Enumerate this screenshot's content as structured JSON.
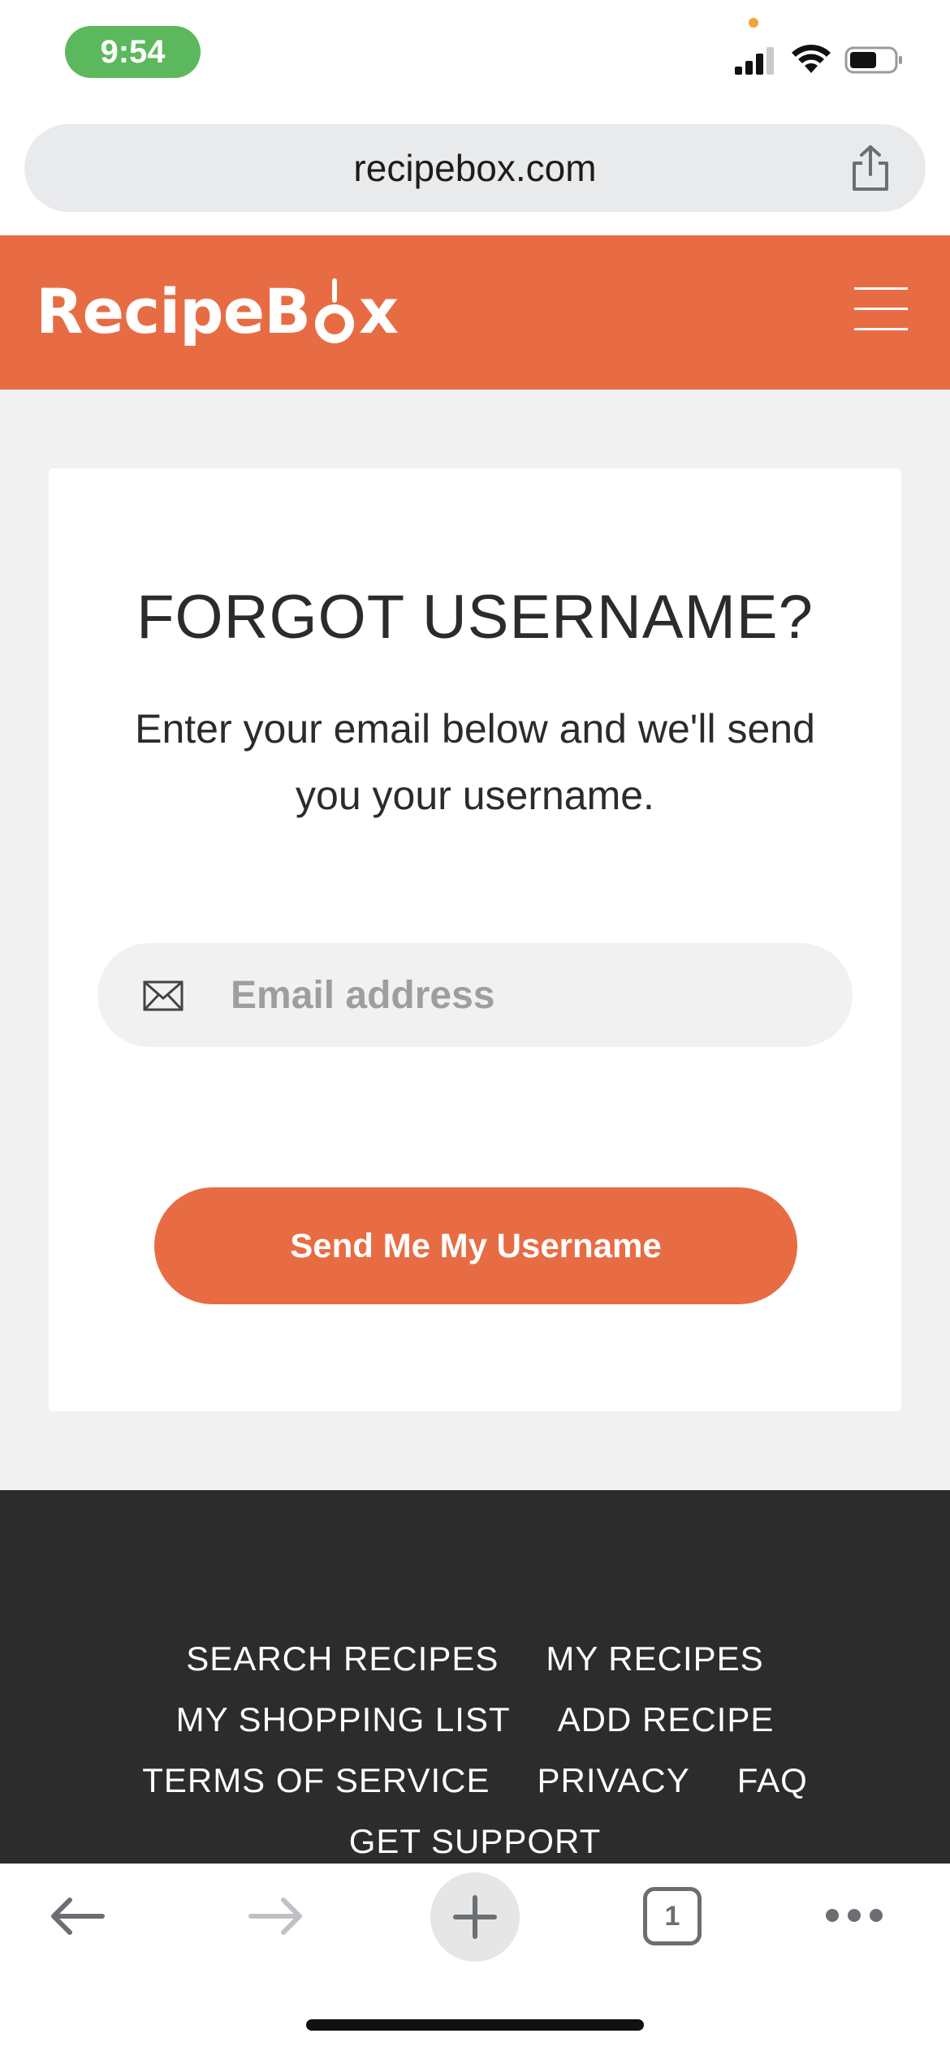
{
  "status_bar": {
    "time": "9:54"
  },
  "browser": {
    "url": "recipebox.com",
    "tab_count": "1"
  },
  "header": {
    "logo_text_start": "RecipeB",
    "logo_text_end": "x"
  },
  "card": {
    "title": "FORGOT USERNAME?",
    "subtitle": "Enter your email below and we'll send you your username.",
    "email_placeholder": "Email address",
    "email_value": "",
    "submit_label": "Send Me My Username"
  },
  "footer": {
    "rows": [
      [
        "SEARCH RECIPES",
        "MY RECIPES"
      ],
      [
        "MY SHOPPING LIST",
        "ADD RECIPE"
      ],
      [
        "TERMS OF SERVICE",
        "PRIVACY",
        "FAQ"
      ],
      [
        "GET SUPPORT"
      ]
    ]
  },
  "colors": {
    "brand": "#e86c43",
    "footer_bg": "#2c2c2c",
    "page_bg": "#f1f1f1"
  }
}
